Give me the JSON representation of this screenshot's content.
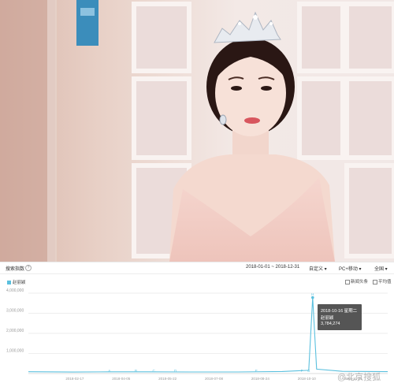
{
  "toolbar": {
    "title": "搜索指数",
    "range": "2018-01-01 ~ 2018-12-31",
    "custom": "自定义",
    "device": "PC+移动",
    "region": "全国"
  },
  "legend": {
    "series": "赵丽颖"
  },
  "options": {
    "news": "新闻头条",
    "average": "平均值"
  },
  "tooltip": {
    "date": "2018-10-16 星期二",
    "series": "赵丽颖",
    "value": "3,784,274"
  },
  "watermark": "@北京搜狐",
  "colors": {
    "line": "#5bc0de"
  },
  "chart_data": {
    "type": "line",
    "xlabel": "",
    "ylabel": "",
    "yticks": [
      "4,000,000",
      "3,000,000",
      "2,000,000",
      "1,000,000"
    ],
    "ylim": [
      0,
      4000000
    ],
    "xticks": [
      "2018-02-17",
      "2018-04-05",
      "2018-05-22",
      "2018-07-08",
      "2018-08-24",
      "2018-10-10",
      "2018-11-26"
    ],
    "markers": [
      "A",
      "B",
      "C",
      "D",
      "E",
      "F",
      "G",
      "H"
    ],
    "grid": true,
    "series": [
      {
        "name": "赵丽颖",
        "x": [
          "2018-01-01",
          "2018-02-15",
          "2018-03-25",
          "2018-05-01",
          "2018-06-15",
          "2018-08-01",
          "2018-09-15",
          "2018-10-12",
          "2018-10-16",
          "2018-10-20",
          "2018-11-15",
          "2018-12-31"
        ],
        "values": [
          90000,
          75000,
          85000,
          85000,
          80000,
          80000,
          100000,
          160000,
          3784274,
          220000,
          110000,
          95000
        ]
      }
    ]
  }
}
